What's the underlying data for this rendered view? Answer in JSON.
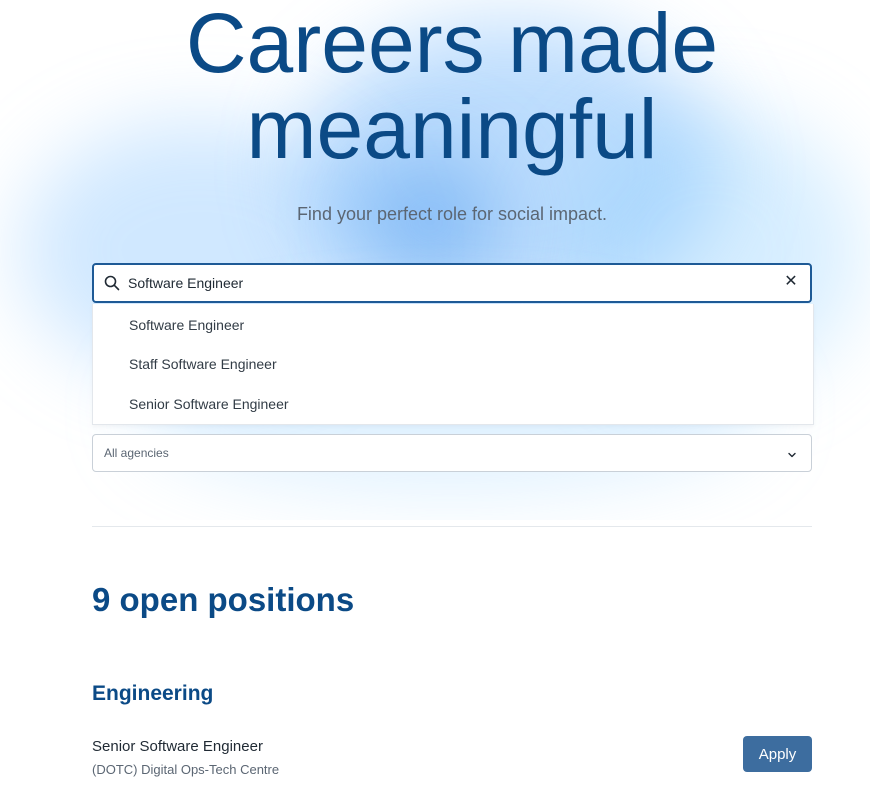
{
  "hero": {
    "title_line1": "Careers made",
    "title_line2": "meaningful",
    "subtitle": "Find your perfect role for social impact."
  },
  "search": {
    "value": "Software Engineer",
    "clear_glyph": "✕",
    "suggestions": [
      "Software Engineer",
      "Staff Software Engineer",
      "Senior Software Engineer"
    ]
  },
  "filters": {
    "agency_selected": "All agencies"
  },
  "results": {
    "count_label": "9 open positions",
    "groups": [
      {
        "department": "Engineering",
        "jobs": [
          {
            "title": "Senior Software Engineer",
            "agency": "(DOTC) Digital Ops-Tech Centre",
            "apply_label": "Apply"
          }
        ]
      }
    ]
  },
  "colors": {
    "primary": "#0b4a86",
    "button": "#3d6d9f",
    "search_border": "#1e5a96"
  },
  "icons": [
    "search-icon",
    "close-icon",
    "chevron-down-icon"
  ]
}
